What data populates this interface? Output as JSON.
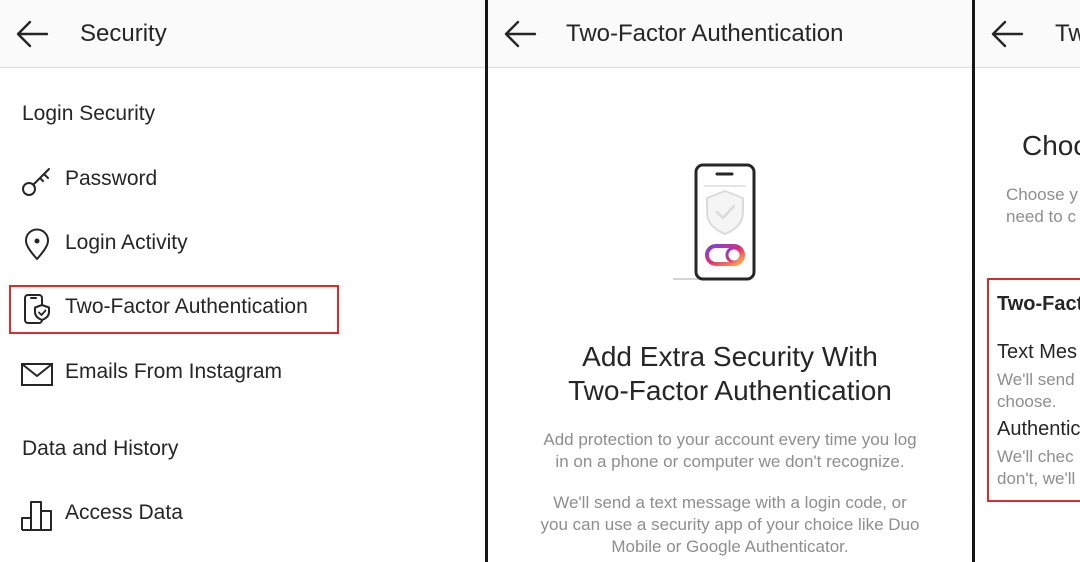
{
  "panels": {
    "security": {
      "title": "Security",
      "login_security_heading": "Login Security",
      "items": [
        {
          "label": "Password",
          "icon": "key-icon"
        },
        {
          "label": "Login Activity",
          "icon": "location-pin-icon"
        },
        {
          "label": "Two-Factor Authentication",
          "icon": "phone-shield-icon"
        },
        {
          "label": "Emails From Instagram",
          "icon": "mail-icon"
        }
      ],
      "data_history_heading": "Data and History",
      "data_items": [
        {
          "label": "Access Data",
          "icon": "bar-chart-icon"
        }
      ]
    },
    "two_factor": {
      "title": "Two-Factor Authentication",
      "headline_line1": "Add Extra Security With",
      "headline_line2": "Two-Factor Authentication",
      "body1_line1": "Add protection to your account every time you log",
      "body1_line2": "in on a phone or computer we don't recognize.",
      "body2_line1": "We'll send a text message with a login code, or",
      "body2_line2": "you can use a security app of your choice like Duo",
      "body2_line3": "Mobile or Google Authenticator."
    },
    "choose_method": {
      "title": "Tw",
      "heading": "Choc",
      "desc_line1": "Choose y",
      "desc_line2": "need to c",
      "section": "Two-Fact",
      "option1_title": "Text Mes",
      "option1_line1": "We'll send",
      "option1_line2": "choose.",
      "option2_title": "Authentic",
      "option2_line1": "We'll chec",
      "option2_line2": "don't, we'll"
    }
  },
  "colors": {
    "highlight": "#d32f2f",
    "text": "#262626",
    "muted": "#8e8e8e",
    "header_bg": "#fafafa"
  }
}
